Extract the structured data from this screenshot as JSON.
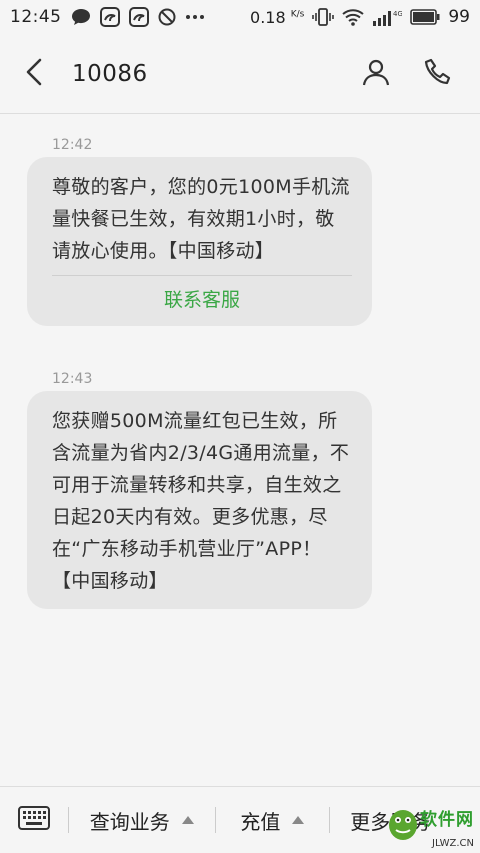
{
  "status_bar": {
    "time": "12:45",
    "speed": "0.18",
    "speed_unit": "K/s",
    "network": "4G",
    "battery": "99",
    "icons": [
      "chat-bubble-icon",
      "uc-browser-icon",
      "uc-browser-icon",
      "do-not-disturb-icon",
      "more-dots-icon",
      "vibrate-icon",
      "wifi-icon",
      "signal-icon",
      "battery-icon"
    ]
  },
  "header": {
    "contact": "10086",
    "icons": [
      "back-arrow-icon",
      "contact-person-icon",
      "phone-icon"
    ]
  },
  "messages": [
    {
      "time": "12:42",
      "text": "尊敬的客户，您的0元100M手机流量快餐已生效，有效期1小时，敬请放心使用。【中国移动】",
      "action": "联系客服"
    },
    {
      "time": "12:43",
      "text": "您获赠500M流量红包已生效，所含流量为省内2/3/4G通用流量，不可用于流量转移和共享，自生效之日起20天内有效。更多优惠，尽在“广东移动手机营业厅”APP！【中国移动】"
    }
  ],
  "bottom_bar": {
    "menus": [
      "查询业务",
      "充值",
      "更多服务"
    ],
    "icons": [
      "keyboard-icon",
      "caret-up-icon"
    ]
  },
  "watermark": {
    "text": "软件网",
    "domain": "JLWZ.CN"
  },
  "colors": {
    "background": "#f5f5f5",
    "bubble": "#e6e6e6",
    "accent_green": "#3aa745"
  }
}
